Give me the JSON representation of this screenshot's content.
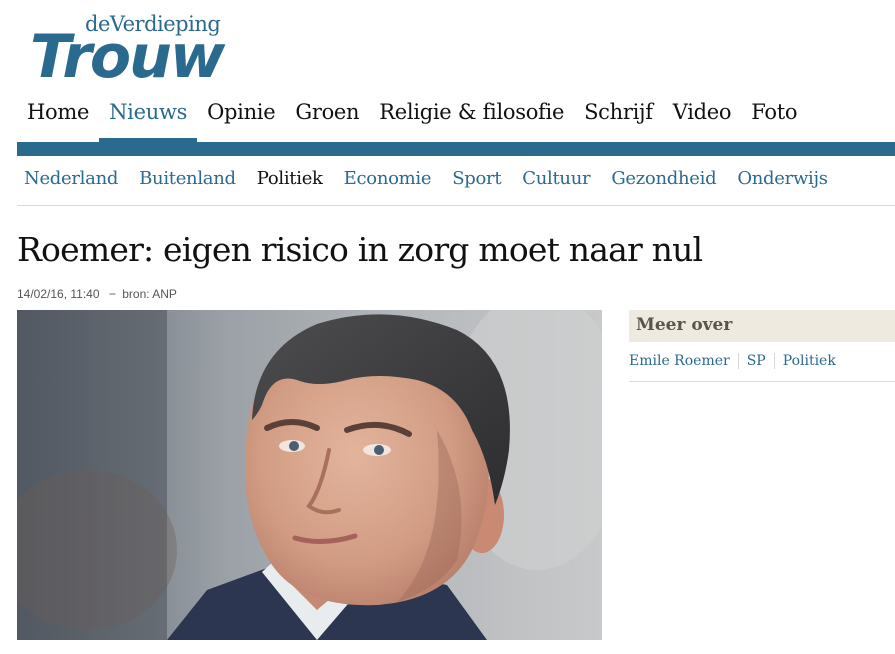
{
  "logo": {
    "subtitle": "deVerdieping",
    "title": "Trouw"
  },
  "main_nav": [
    {
      "label": "Home",
      "active": false
    },
    {
      "label": "Nieuws",
      "active": true
    },
    {
      "label": "Opinie",
      "active": false
    },
    {
      "label": "Groen",
      "active": false
    },
    {
      "label": "Religie & filosofie",
      "active": false
    },
    {
      "label": "Schrijf",
      "active": false
    },
    {
      "label": "Video",
      "active": false
    },
    {
      "label": "Foto",
      "active": false
    }
  ],
  "sub_nav": [
    {
      "label": "Nederland",
      "active": false
    },
    {
      "label": "Buitenland",
      "active": false
    },
    {
      "label": "Politiek",
      "active": true
    },
    {
      "label": "Economie",
      "active": false
    },
    {
      "label": "Sport",
      "active": false
    },
    {
      "label": "Cultuur",
      "active": false
    },
    {
      "label": "Gezondheid",
      "active": false
    },
    {
      "label": "Onderwijs",
      "active": false
    }
  ],
  "article": {
    "headline": "Roemer: eigen risico in zorg moet naar nul",
    "timestamp": "14/02/16, 11:40",
    "separator": "−",
    "source": "bron: ANP"
  },
  "sidebar": {
    "heading": "Meer over",
    "tags": [
      "Emile Roemer",
      "SP",
      "Politiek"
    ]
  },
  "colors": {
    "brand": "#2b6a8f",
    "text": "#111111",
    "sidebar_heading_bg": "#efeae0"
  }
}
